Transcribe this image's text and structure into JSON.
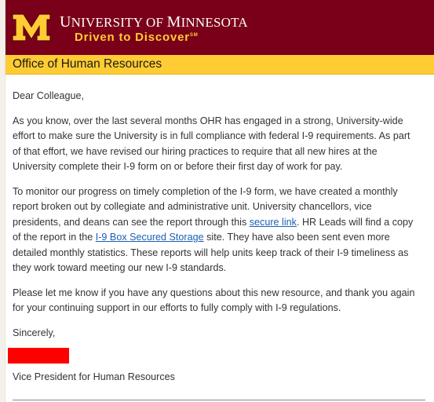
{
  "header": {
    "university_name_prefix": "U",
    "university_name_small": "NIVERSITY OF ",
    "university_name_m": "M",
    "university_name_rest": "INNESOTA",
    "tagline": "Driven to Discover",
    "tagline_mark": "SM",
    "brand_colors": {
      "maroon": "#7a0019",
      "gold": "#ffcc33"
    },
    "logo_icon": "university-block-m-logo"
  },
  "office": {
    "title": "Office of Human Resources"
  },
  "letter": {
    "greeting": "Dear Colleague,",
    "para1": "As you know, over the last several months OHR has engaged in a strong, University-wide effort to make sure the University is in full compliance with federal I-9 requirements. As part of that effort, we have revised our hiring practices to require that all new hires at the University complete their I-9 form on or before their first day of work for pay.",
    "para2_a": "To monitor our progress on timely completion of the I-9 form, we have created a monthly report broken out by collegiate and administrative unit. University chancellors, vice presidents, and deans can see the report through this ",
    "para2_link1": "secure link",
    "para2_b": ". HR Leads will find a copy of the report in the ",
    "para2_link2": "I-9 Box Secured Storage",
    "para2_c": " site. They have also been sent even more detailed monthly statistics. These reports will help units keep track of their I-9 timeliness as they work toward meeting our new I-9 standards.",
    "para3": "Please let me know if you have any questions about this new resource, and thank you again for your continuing support in our efforts to fully comply with I-9 regulations.",
    "closing": "Sincerely,",
    "signer_title": "Vice President for Human Resources"
  }
}
